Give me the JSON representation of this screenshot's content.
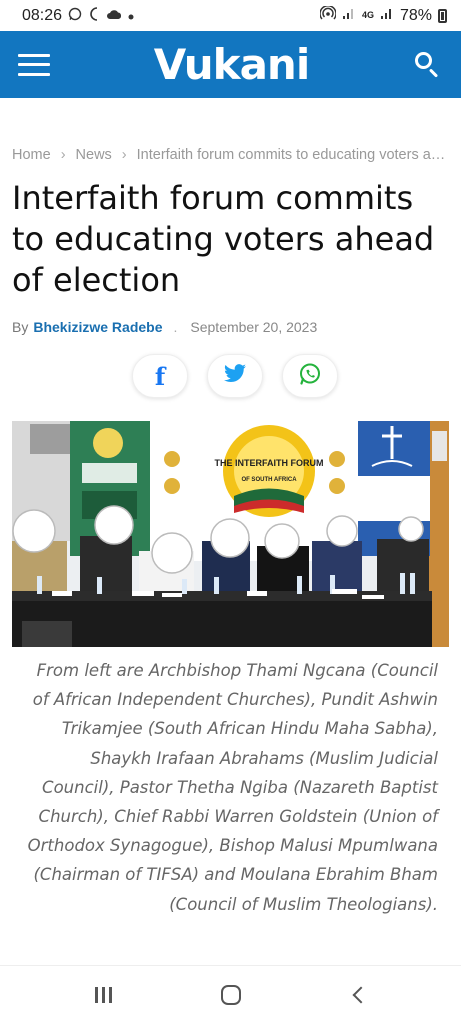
{
  "status_bar": {
    "time": "08:26",
    "left_icons": [
      "whatsapp-icon",
      "moon-icon",
      "cloud-icon",
      "dot-icon"
    ],
    "network": "4G",
    "battery": "78%"
  },
  "header": {
    "logo": "Vukani",
    "menu_icon": "hamburger-icon",
    "search_icon": "search-icon",
    "background": "#1276c0"
  },
  "breadcrumb": {
    "home": "Home",
    "section": "News",
    "current": "Interfaith forum commits to educating voters ahead of election"
  },
  "article": {
    "title": "Interfaith forum commits to educating voters ahead of election",
    "by_label": "By",
    "author": "Bhekizizwe Radebe",
    "date": "September 20, 2023",
    "share": [
      "facebook-icon",
      "twitter-icon",
      "whatsapp-icon"
    ],
    "photo": {
      "banner_title": "THE INTERFAITH FORUM",
      "banner_subtitle": "OF SOUTH AFRICA"
    },
    "caption": "From left are Archbishop Thami Ngcana (Council of African Independent Churches), Pundit Ashwin Trikamjee (South African Hindu Maha Sabha), Shaykh Irafaan Abrahams (Muslim Judicial Council), Pastor Thetha Ngiba (Nazareth Baptist Church), Chief Rabbi Warren Goldstein (Union of Orthodox Synagogue), Bishop Malusi Mpumlwana (Chairman of TIFSA) and Moulana Ebrahim Bham (Council of Muslim Theologians)."
  },
  "nav_bar": {
    "buttons": [
      "recents-icon",
      "home-icon",
      "back-icon"
    ]
  }
}
